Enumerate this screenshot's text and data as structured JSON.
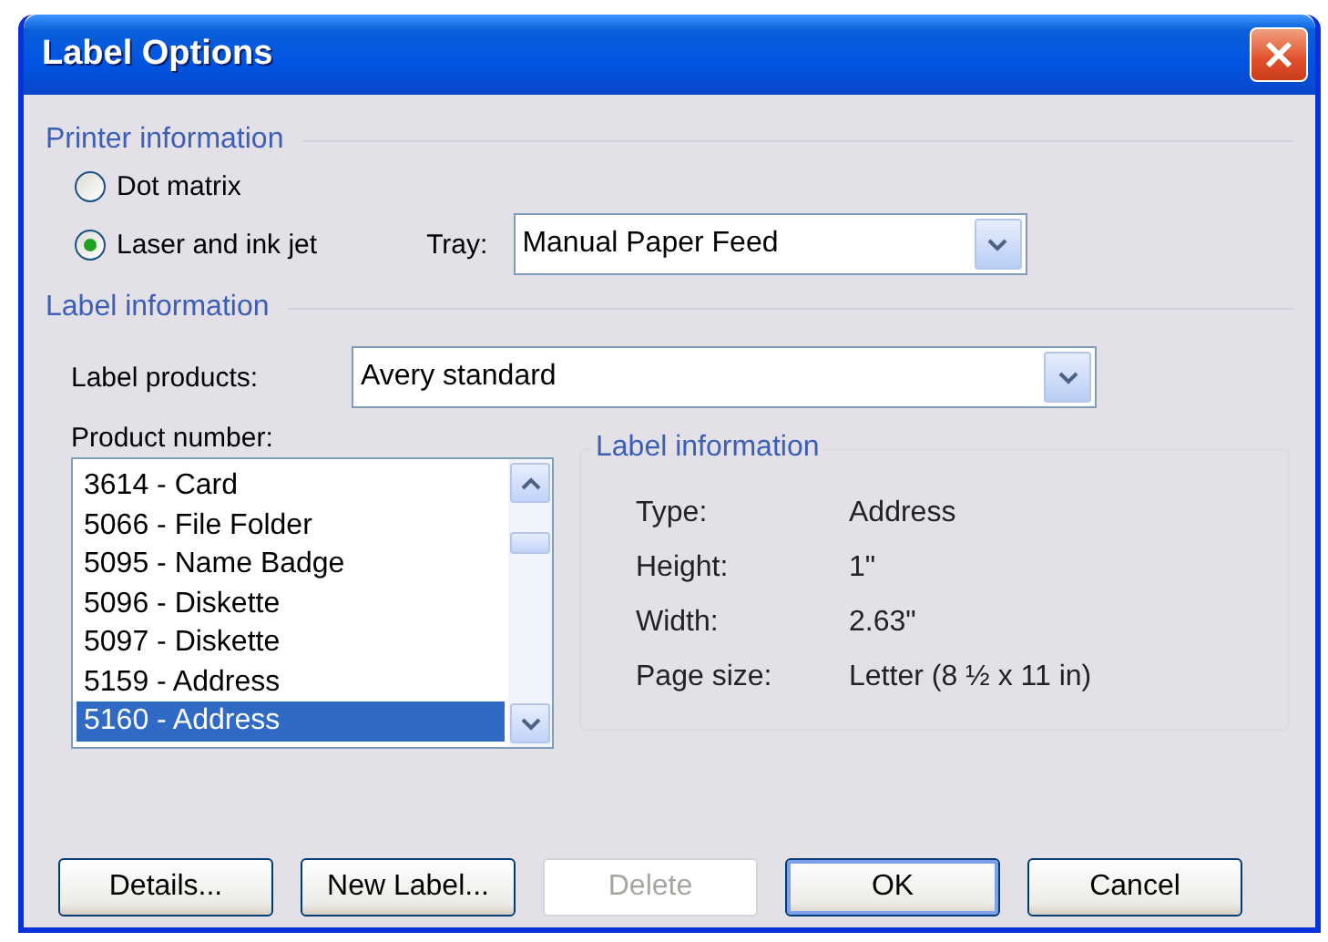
{
  "window": {
    "title": "Label Options"
  },
  "printer_information": {
    "heading": "Printer information",
    "options": [
      {
        "label": "Dot matrix",
        "selected": false
      },
      {
        "label": "Laser and ink jet",
        "selected": true
      }
    ],
    "tray": {
      "label": "Tray:",
      "value": "Manual Paper Feed"
    }
  },
  "label_information": {
    "heading": "Label information",
    "label_products": {
      "label": "Label products:",
      "value": "Avery standard"
    },
    "product_number": {
      "label": "Product number:",
      "items": [
        {
          "text": "3614 - Card",
          "selected": false
        },
        {
          "text": "5066 - File Folder",
          "selected": false
        },
        {
          "text": "5095 - Name Badge",
          "selected": false
        },
        {
          "text": "5096 - Diskette",
          "selected": false
        },
        {
          "text": "5097 - Diskette",
          "selected": false
        },
        {
          "text": "5159 - Address",
          "selected": false
        },
        {
          "text": "5160 - Address",
          "selected": true
        }
      ]
    },
    "details": {
      "heading": "Label information",
      "rows": [
        {
          "label": "Type:",
          "value": "Address"
        },
        {
          "label": "Height:",
          "value": "1\""
        },
        {
          "label": "Width:",
          "value": "2.63\""
        },
        {
          "label": "Page size:",
          "value": "Letter (8 ½ x 11 in)"
        }
      ]
    }
  },
  "buttons": [
    {
      "label": "Details...",
      "disabled": false,
      "default": false
    },
    {
      "label": "New Label...",
      "disabled": false,
      "default": false
    },
    {
      "label": "Delete",
      "disabled": true,
      "default": false
    },
    {
      "label": "OK",
      "disabled": false,
      "default": true
    },
    {
      "label": "Cancel",
      "disabled": false,
      "default": false
    }
  ]
}
